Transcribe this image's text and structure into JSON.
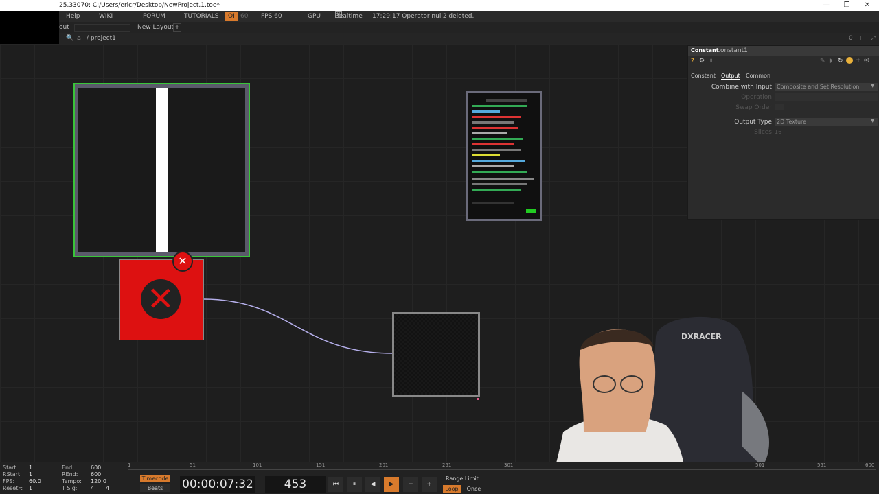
{
  "window": {
    "title": "25.33070: C:/Users/ericr/Desktop/NewProject.1.toe*"
  },
  "menubar": {
    "help": "Help",
    "wiki": "WIKI",
    "forum": "FORUM",
    "tutorials": "TUTORIALS",
    "oi": "OI",
    "sixty": "60",
    "fps": "FPS  60",
    "gpu": "GPU",
    "realtime": "Realtime",
    "status": "17:29:17 Operator null2 deleted."
  },
  "toolbar2": {
    "partial": "out",
    "layout": "New Layout",
    "add": "+"
  },
  "path": {
    "text": "/ project1",
    "zero": "0"
  },
  "params": {
    "op_type": "Constant",
    "op_name": "constant1",
    "tabs": [
      "Constant",
      "Output",
      "Common"
    ],
    "combine_label": "Combine with Input",
    "combine_value": "Composite and Set Resolution",
    "operation_label": "Operation",
    "swap_label": "Swap Order",
    "output_type_label": "Output Type",
    "output_type_value": "2D Texture",
    "slices_label": "Slices",
    "slices_value": "16"
  },
  "timeline": {
    "start": "Start:",
    "start_val": "1",
    "rstart": "RStart:",
    "rstart_val": "1",
    "fps": "FPS:",
    "fps_val": "60.0",
    "resetf": "ResetF:",
    "resetf_val": "1",
    "end": "End:",
    "end_val": "600",
    "rend": "REnd:",
    "rend_val": "600",
    "tempo": "Tempo:",
    "tempo_val": "120.0",
    "tsig": "T Sig:",
    "tsig_val1": "4",
    "tsig_val2": "4",
    "ruler": [
      "1",
      "51",
      "101",
      "151",
      "201",
      "251",
      "301",
      "501",
      "551",
      "600"
    ],
    "timecode_btn": "Timecode",
    "beats_btn": "Beats",
    "timecode": "00:00:07:32",
    "frame": "453",
    "range_limit": "Range Limit",
    "loop": "Loop",
    "once": "Once"
  },
  "webcam": {
    "chair_brand": "DXRACER"
  }
}
